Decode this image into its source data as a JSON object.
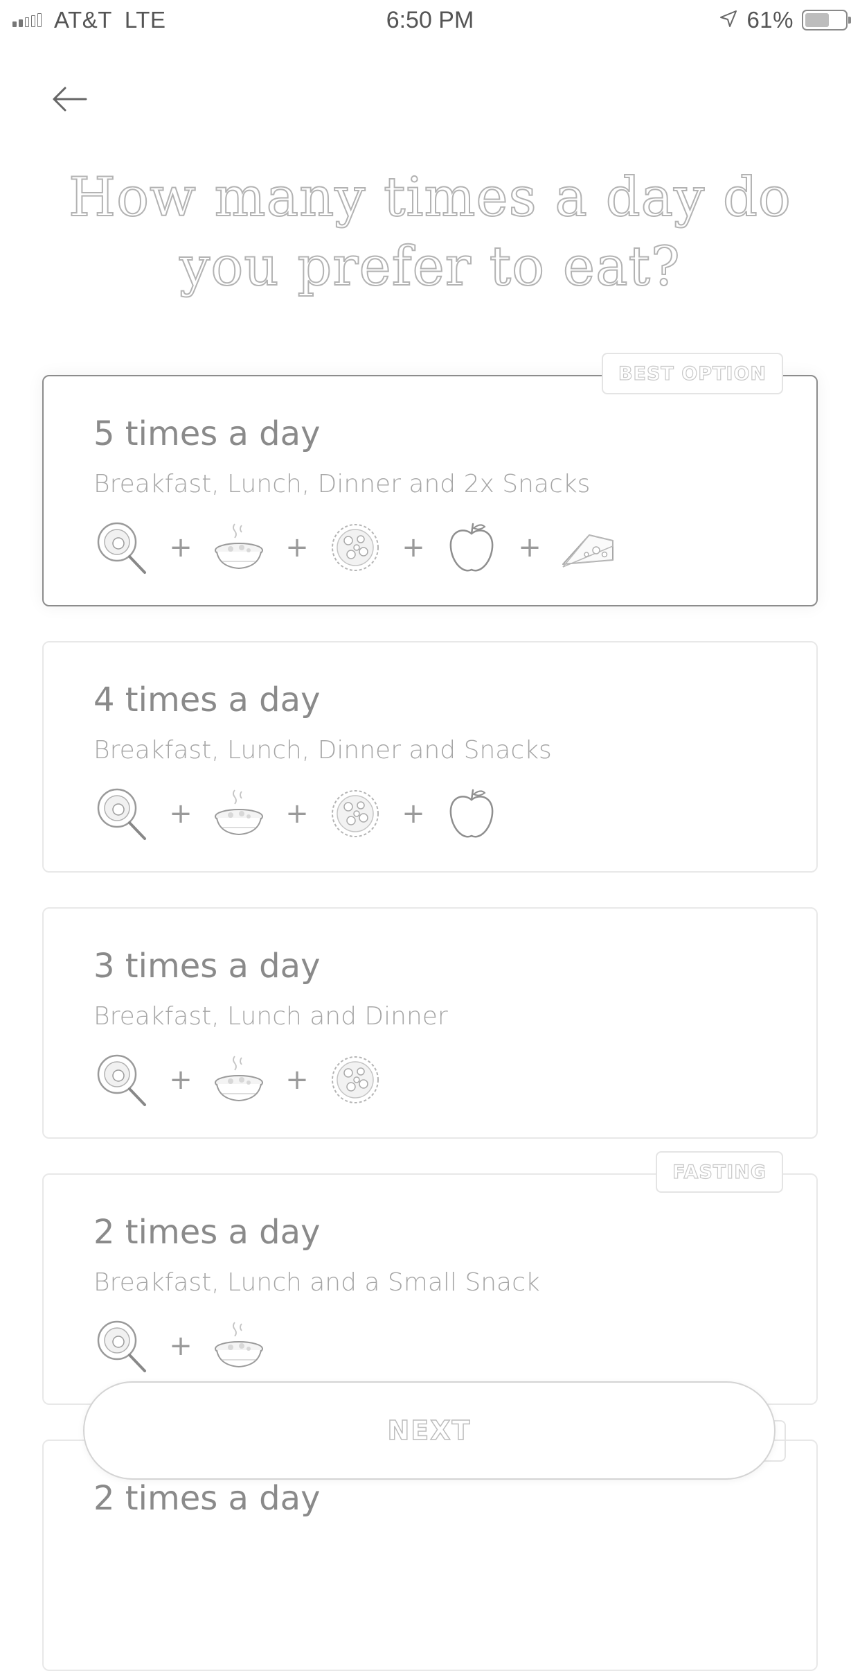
{
  "status_bar": {
    "carrier": "AT&T",
    "network": "LTE",
    "time": "6:50 PM",
    "battery": "61%",
    "battery_level": 0.61
  },
  "title": "How many times a day do you prefer to eat?",
  "options": [
    {
      "title": "5 times a day",
      "description": "Breakfast, Lunch, Dinner and 2x Snacks",
      "badge": "BEST OPTION",
      "selected": true,
      "icons": [
        "breakfast-icon",
        "lunch-icon",
        "dinner-icon",
        "apple-icon",
        "cheese-icon"
      ]
    },
    {
      "title": "4 times a day",
      "description": "Breakfast, Lunch, Dinner and Snacks",
      "selected": false,
      "icons": [
        "breakfast-icon",
        "lunch-icon",
        "dinner-icon",
        "apple-icon"
      ]
    },
    {
      "title": "3 times a day",
      "description": "Breakfast, Lunch and Dinner",
      "selected": false,
      "icons": [
        "breakfast-icon",
        "lunch-icon",
        "dinner-icon"
      ]
    },
    {
      "title": "2 times a day",
      "description": "Breakfast, Lunch and a Small Snack",
      "badge": "FASTING",
      "selected": false,
      "icons": [
        "breakfast-icon",
        "lunch-icon"
      ]
    },
    {
      "title": "2 times a day",
      "selected": false
    }
  ],
  "plus_sign": "+",
  "next_label": "NEXT"
}
